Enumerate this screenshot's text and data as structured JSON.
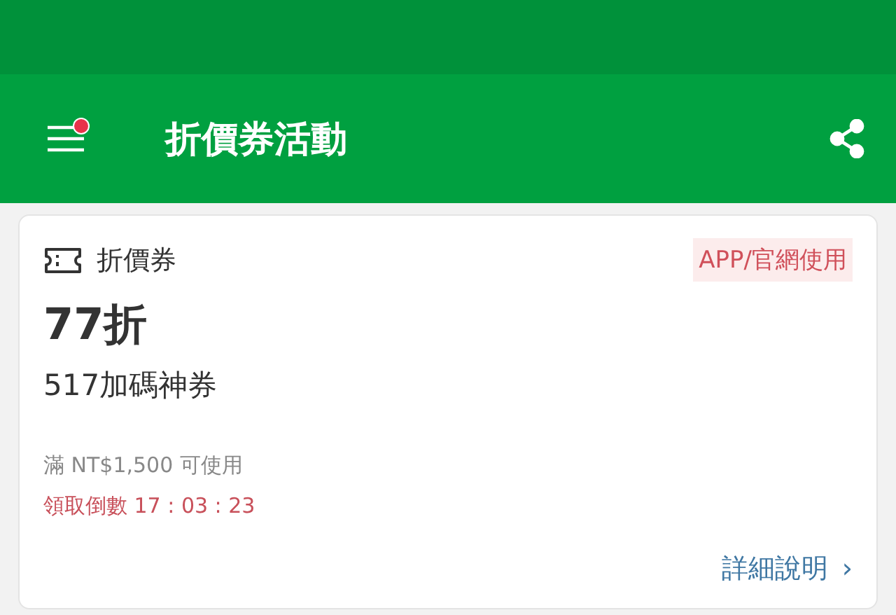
{
  "app_bar": {
    "title": "折價券活動",
    "menu_notification": true
  },
  "coupon": {
    "type_label": "折價券",
    "channel_badge": "APP/官網使用",
    "discount": "77折",
    "name": "517加碼神券",
    "condition": "滿 NT$1,500 可使用",
    "countdown": "領取倒數 17 : 03 : 23",
    "details_link": "詳細說明",
    "details_chevron": "›"
  }
}
